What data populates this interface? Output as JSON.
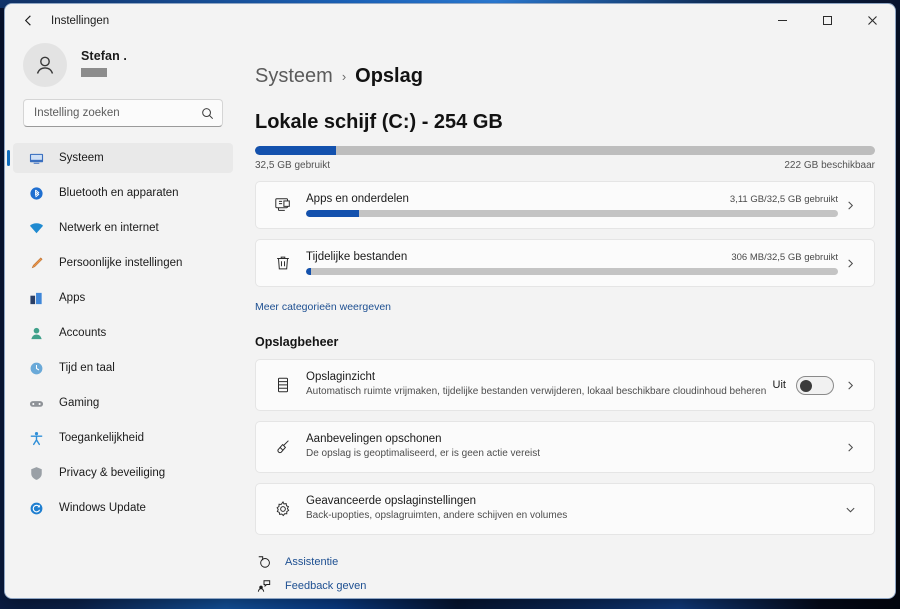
{
  "window": {
    "title": "Instellingen",
    "back_icon": "back-arrow-icon",
    "minimize_label": "Minimaliseren",
    "maximize_label": "Maximaliseren",
    "close_label": "Sluiten"
  },
  "sidebar": {
    "profile": {
      "name": "Stefan .",
      "avatar_icon": "user-avatar-icon"
    },
    "search": {
      "placeholder": "Instelling zoeken",
      "value": "",
      "icon": "search-icon"
    },
    "items": [
      {
        "label": "Systeem",
        "icon": "system-icon",
        "active": true
      },
      {
        "label": "Bluetooth en apparaten",
        "icon": "bluetooth-icon",
        "active": false
      },
      {
        "label": "Netwerk en internet",
        "icon": "network-icon",
        "active": false
      },
      {
        "label": "Persoonlijke instellingen",
        "icon": "personalization-icon",
        "active": false
      },
      {
        "label": "Apps",
        "icon": "apps-icon",
        "active": false
      },
      {
        "label": "Accounts",
        "icon": "accounts-icon",
        "active": false
      },
      {
        "label": "Tijd en taal",
        "icon": "time-language-icon",
        "active": false
      },
      {
        "label": "Gaming",
        "icon": "gaming-icon",
        "active": false
      },
      {
        "label": "Toegankelijkheid",
        "icon": "accessibility-icon",
        "active": false
      },
      {
        "label": "Privacy & beveiliging",
        "icon": "privacy-shield-icon",
        "active": false
      },
      {
        "label": "Windows Update",
        "icon": "windows-update-icon",
        "active": false
      }
    ]
  },
  "main": {
    "breadcrumb": {
      "parent": "Systeem",
      "separator": "›",
      "current": "Opslag"
    },
    "drive": {
      "title": "Lokale schijf (C:) - 254 GB",
      "used_label": "32,5 GB gebruikt",
      "free_label": "222 GB beschikbaar",
      "used_percent": 13
    },
    "categories": [
      {
        "name": "Apps en onderdelen",
        "size": "3,11 GB/32,5 GB gebruikt",
        "icon": "apps-monitor-icon",
        "percent": 10,
        "chevron": "chevron-right-icon"
      },
      {
        "name": "Tijdelijke bestanden",
        "size": "306 MB/32,5 GB gebruikt",
        "icon": "trash-icon",
        "percent": 1,
        "chevron": "chevron-right-icon"
      }
    ],
    "more_categories_link": "Meer categorieën weergeven",
    "management_heading": "Opslagbeheer",
    "options": [
      {
        "title": "Opslaginzicht",
        "desc": "Automatisch ruimte vrijmaken, tijdelijke bestanden verwijderen, lokaal beschikbare cloudinhoud beheren",
        "icon": "storage-sense-icon",
        "toggle_label": "Uit",
        "toggle_on": false,
        "chevron": "chevron-right-icon"
      },
      {
        "title": "Aanbevelingen opschonen",
        "desc": "De opslag is geoptimaliseerd, er is geen actie vereist",
        "icon": "broom-icon",
        "chevron": "chevron-right-icon"
      },
      {
        "title": "Geavanceerde opslaginstellingen",
        "desc": "Back-upopties, opslagruimten, andere schijven en volumes",
        "icon": "gear-icon",
        "chevron": "chevron-down-icon"
      }
    ],
    "footer_links": [
      {
        "label": "Assistentie",
        "icon": "help-icon"
      },
      {
        "label": "Feedback geven",
        "icon": "feedback-icon"
      }
    ]
  },
  "colors": {
    "accent": "#1351ad",
    "link": "#1d4f91",
    "window_bg": "#f3f3f3",
    "card_bg": "#fbfbfb"
  }
}
